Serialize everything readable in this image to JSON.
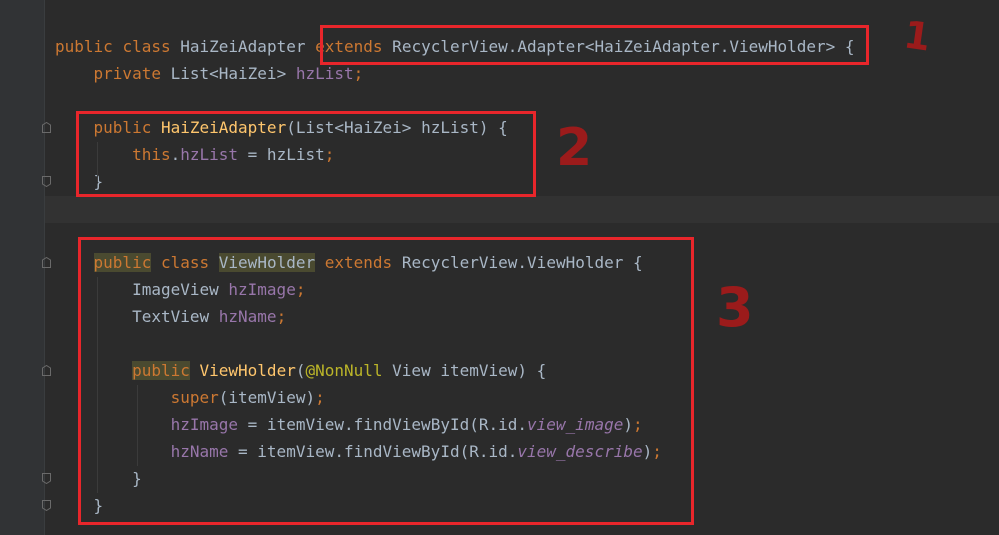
{
  "editor": {
    "line_top": "    public         HaiZeiAdapter",
    "lines": [
      {
        "tokens": [
          {
            "t": "public",
            "c": "kw"
          },
          {
            "t": " "
          },
          {
            "t": "class",
            "c": "kw"
          },
          {
            "t": " HaiZeiAdapter "
          },
          {
            "t": "extends",
            "c": "kw"
          },
          {
            "t": " RecyclerView.Adapter<HaiZeiAdapter.ViewHolder> {"
          }
        ]
      },
      {
        "tokens": [
          {
            "t": "    "
          },
          {
            "t": "private",
            "c": "kw"
          },
          {
            "t": " List<HaiZei> "
          },
          {
            "t": "hzList",
            "c": "fld"
          },
          {
            "t": ";",
            "c": "kw"
          }
        ]
      },
      {
        "tokens": []
      },
      {
        "tokens": [
          {
            "t": "    "
          },
          {
            "t": "public",
            "c": "kw"
          },
          {
            "t": " "
          },
          {
            "t": "HaiZeiAdapter",
            "c": "fn"
          },
          {
            "t": "(List<HaiZei> hzList) {"
          }
        ]
      },
      {
        "tokens": [
          {
            "t": "        "
          },
          {
            "t": "this",
            "c": "kw"
          },
          {
            "t": "."
          },
          {
            "t": "hzList",
            "c": "fld"
          },
          {
            "t": " = hzList"
          },
          {
            "t": ";",
            "c": "kw"
          }
        ]
      },
      {
        "tokens": [
          {
            "t": "    }"
          }
        ]
      },
      {
        "tokens": []
      },
      {
        "tokens": []
      },
      {
        "tokens": [
          {
            "t": "    "
          },
          {
            "t": "public",
            "c": "kw hl"
          },
          {
            "t": " "
          },
          {
            "t": "class",
            "c": "kw"
          },
          {
            "t": " "
          },
          {
            "t": "ViewHolder",
            "c": "hl"
          },
          {
            "t": " "
          },
          {
            "t": "extends",
            "c": "kw"
          },
          {
            "t": " RecyclerView.ViewHolder {"
          }
        ]
      },
      {
        "tokens": [
          {
            "t": "        ImageView "
          },
          {
            "t": "hzImage",
            "c": "fld"
          },
          {
            "t": ";",
            "c": "kw"
          }
        ]
      },
      {
        "tokens": [
          {
            "t": "        TextView "
          },
          {
            "t": "hzName",
            "c": "fld"
          },
          {
            "t": ";",
            "c": "kw"
          }
        ]
      },
      {
        "tokens": []
      },
      {
        "tokens": [
          {
            "t": "        "
          },
          {
            "t": "public",
            "c": "kw hl"
          },
          {
            "t": " "
          },
          {
            "t": "ViewHolder",
            "c": "fn"
          },
          {
            "t": "("
          },
          {
            "t": "@NonNull",
            "c": "ann"
          },
          {
            "t": " View itemView) {"
          }
        ]
      },
      {
        "tokens": [
          {
            "t": "            "
          },
          {
            "t": "super",
            "c": "kw"
          },
          {
            "t": "(itemView)"
          },
          {
            "t": ";",
            "c": "kw"
          }
        ]
      },
      {
        "tokens": [
          {
            "t": "            "
          },
          {
            "t": "hzImage",
            "c": "fld"
          },
          {
            "t": " = itemView.findViewById(R.id."
          },
          {
            "t": "view_image",
            "c": "it"
          },
          {
            "t": ")"
          },
          {
            "t": ";",
            "c": "kw"
          }
        ]
      },
      {
        "tokens": [
          {
            "t": "            "
          },
          {
            "t": "hzName",
            "c": "fld"
          },
          {
            "t": " = itemView.findViewById(R.id."
          },
          {
            "t": "view_describe",
            "c": "it"
          },
          {
            "t": ")"
          },
          {
            "t": ";",
            "c": "kw"
          }
        ]
      },
      {
        "tokens": [
          {
            "t": "        }"
          }
        ]
      },
      {
        "tokens": [
          {
            "t": "    }"
          }
        ]
      }
    ]
  },
  "annotations": {
    "mark1": "1",
    "mark2": "2",
    "mark3": "3"
  },
  "colors": {
    "background": "#2b2b2b",
    "keyword": "#cc7832",
    "field": "#9876aa",
    "function": "#ffc66d",
    "annotation": "#bbb529",
    "highlight_box": "#e8262b"
  }
}
